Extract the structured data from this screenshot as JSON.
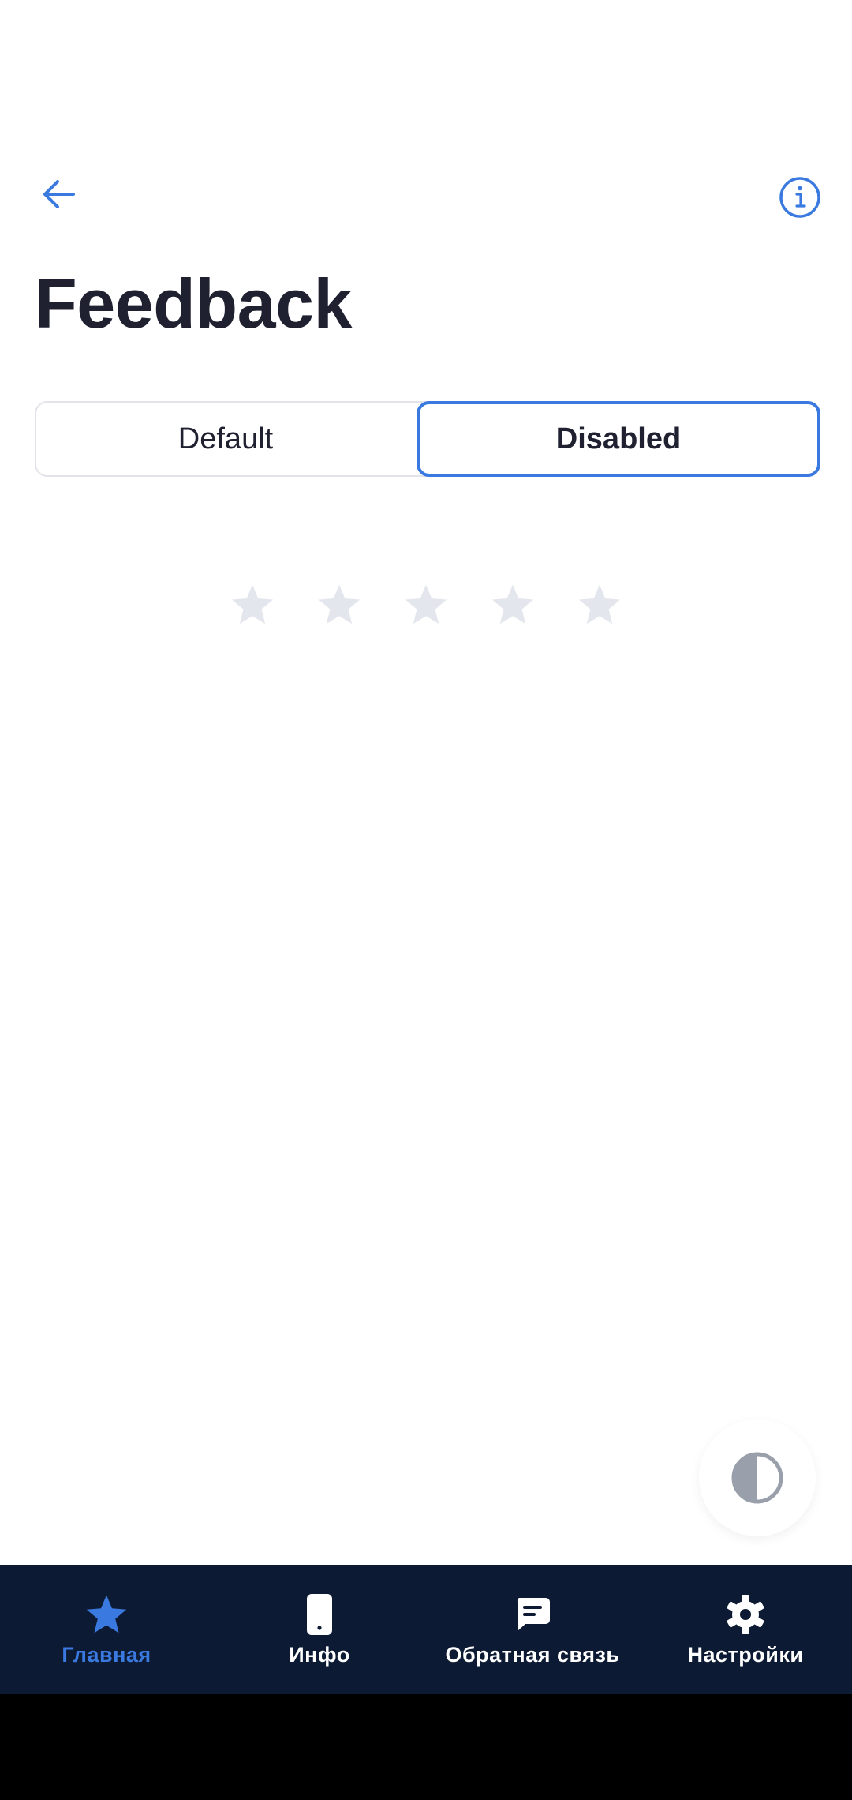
{
  "header": {
    "back_icon": "arrow-left-icon",
    "info_icon": "info-icon",
    "title": "Feedback"
  },
  "segments": {
    "items": [
      {
        "label": "Default",
        "selected": false
      },
      {
        "label": "Disabled",
        "selected": true
      }
    ]
  },
  "rating": {
    "stars_total": 5,
    "stars_filled": 0,
    "disabled": true
  },
  "theme_toggle": {
    "icon": "contrast-icon"
  },
  "bottom_nav": {
    "items": [
      {
        "label": "Главная",
        "icon": "star-icon",
        "active": true
      },
      {
        "label": "Инфо",
        "icon": "phone-icon",
        "active": false
      },
      {
        "label": "Обратная связь",
        "icon": "chat-icon",
        "active": false
      },
      {
        "label": "Настройки",
        "icon": "gear-icon",
        "active": false
      }
    ]
  },
  "colors": {
    "accent": "#3a7ae0",
    "title_text": "#1f2030",
    "star_disabled": "#e3e6ec",
    "nav_background": "#0d1a33",
    "nav_text": "#ffffff"
  }
}
